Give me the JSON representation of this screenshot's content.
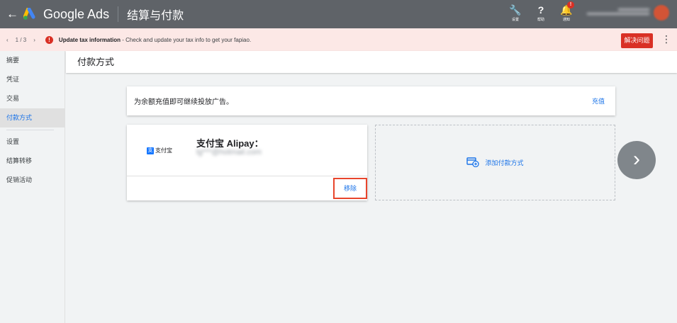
{
  "topbar": {
    "back": "←",
    "brand": "Google Ads",
    "title": "结算与付款",
    "icons": [
      {
        "name": "wrench-icon",
        "glyph": "🔧",
        "label": "设置"
      },
      {
        "name": "help-icon",
        "glyph": "?",
        "label": "帮助"
      },
      {
        "name": "bell-icon",
        "glyph": "🔔",
        "label": "通知",
        "badge": "!"
      }
    ]
  },
  "alert": {
    "prev": "‹",
    "page": "1 / 3",
    "next": "›",
    "icon": "!",
    "title": "Update tax information",
    "message": " - Check and update your tax info to get your fapiao.",
    "action": "解决问题",
    "more": "⋮"
  },
  "sidebar": {
    "items": [
      "摘要",
      "凭证",
      "交易",
      "付款方式",
      "设置",
      "结算转移",
      "促销活动"
    ]
  },
  "header": {
    "title": "付款方式"
  },
  "topup": {
    "message": "为余额充值即可继续投放广告。",
    "action": "充值"
  },
  "payment": {
    "logo_text": "支付宝",
    "logo_glyph": "支",
    "name": "支付宝 Alipay：",
    "email": "lg***@hotmail.com",
    "remove": "移除"
  },
  "add": {
    "label": "添加付款方式"
  },
  "carousel": {
    "next": "›"
  }
}
